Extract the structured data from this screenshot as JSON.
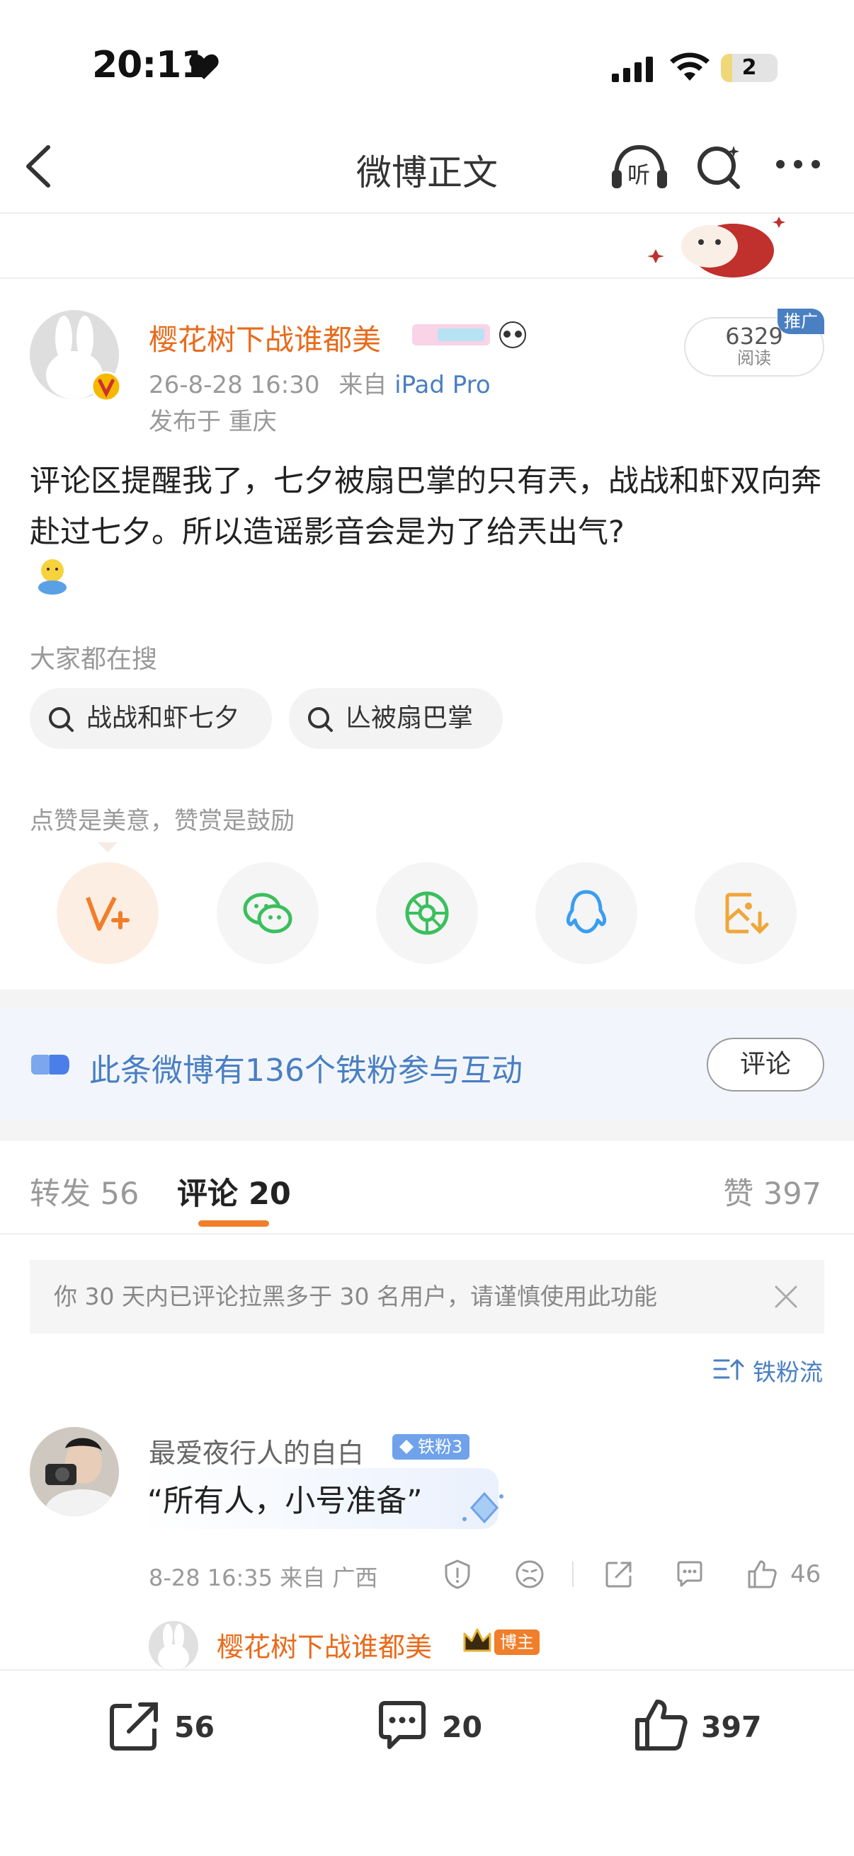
{
  "status_bar": {
    "time": "20:11",
    "battery": "2",
    "battery_level": 0.2
  },
  "nav": {
    "title": "微博正文",
    "listen_label": "听"
  },
  "post": {
    "author": "樱花树下战谁都美",
    "date": "26-8-28 16:30",
    "source_prefix": "来自",
    "device": "iPad Pro",
    "location": "发布于 重庆",
    "reads": "6329",
    "reads_label": "阅读",
    "promo_tag": "推广",
    "body": "评论区提醒我了，七夕被扇巴掌的只有兲，战战和虾双向奔赴过七夕。所以造谣影音会是为了给兲出气?"
  },
  "hot_search": {
    "title": "大家都在搜",
    "chips": [
      "战战和虾七夕",
      "亾被扇巴掌"
    ]
  },
  "reward": {
    "hint": "点赞是美意，赞赏是鼓励"
  },
  "fans_banner": {
    "text": "此条微博有136个铁粉参与互动",
    "button": "评论"
  },
  "tabs": {
    "repost": "转发 56",
    "comment": "评论 20",
    "like": "赞 397"
  },
  "notice": {
    "text": "你 30 天内已评论拉黑多于 30 名用户，请谨慎使用此功能"
  },
  "sort": {
    "label": "铁粉流"
  },
  "comment": {
    "user": "最爱夜行人的自白",
    "badge": "铁粉3",
    "text": "“所有人，小号准备”",
    "meta": "8-28 16:35 来自 广西",
    "likes": "46"
  },
  "reply": {
    "user": "樱花树下战谁都美",
    "tag": "博主"
  },
  "bottom_bar": {
    "reposts": "56",
    "comments": "20",
    "likes": "397"
  },
  "colors": {
    "accent": "#e86b1b",
    "link": "#4a7fc1",
    "tab_indicator": "#f07e2a"
  }
}
